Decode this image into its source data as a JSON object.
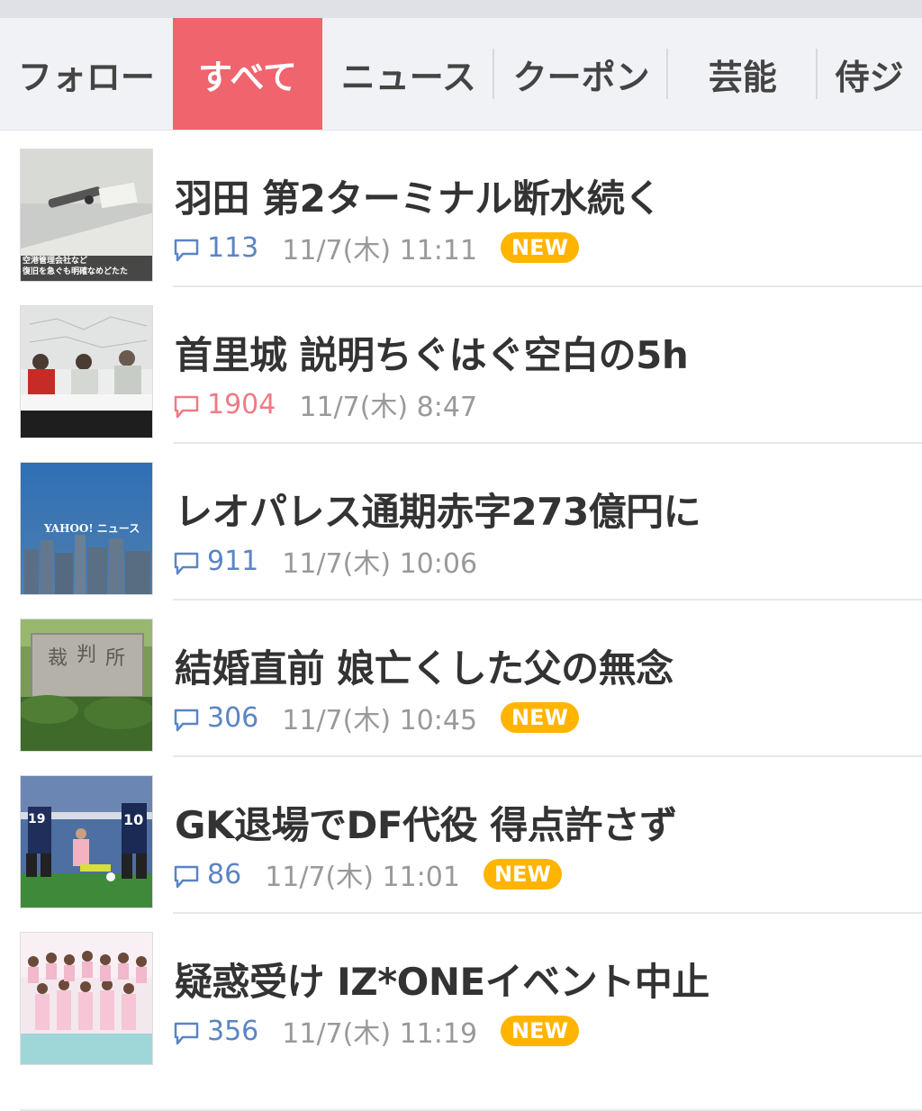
{
  "tabs": [
    {
      "label": "フォロー",
      "active": false
    },
    {
      "label": "すべて",
      "active": true
    },
    {
      "label": "ニュース",
      "active": false
    },
    {
      "label": "クーポン",
      "active": false
    },
    {
      "label": "芸能",
      "active": false
    },
    {
      "label": "侍ジ",
      "active": false
    }
  ],
  "articles": [
    {
      "title": "羽田 第2ターミナル断水続く",
      "comments": "113",
      "date": "11/7(木) 11:11",
      "badge": "NEW",
      "hot": false,
      "thumb_caption": [
        "空港管理会社など",
        "復旧を急ぐも明確なめどたた"
      ]
    },
    {
      "title": "首里城 説明ちぐはぐ空白の5h",
      "comments": "1904",
      "date": "11/7(木) 8:47",
      "badge": "",
      "hot": true
    },
    {
      "title": "レオパレス通期赤字273億円に",
      "comments": "911",
      "date": "11/7(木) 10:06",
      "badge": "",
      "hot": false,
      "thumb_logo": "YAHOO! ニュース"
    },
    {
      "title": "結婚直前 娘亡くした父の無念",
      "comments": "306",
      "date": "11/7(木) 10:45",
      "badge": "NEW",
      "hot": false
    },
    {
      "title": "GK退場でDF代役 得点許さず",
      "comments": "86",
      "date": "11/7(木) 11:01",
      "badge": "NEW",
      "hot": false
    },
    {
      "title": "疑惑受け IZ*ONEイベント中止",
      "comments": "356",
      "date": "11/7(木) 11:19",
      "badge": "NEW",
      "hot": false
    }
  ],
  "colors": {
    "active_tab": "#f0646d",
    "comment_blue": "#5b84c4",
    "comment_hot": "#f07a84",
    "badge": "#ffb400"
  }
}
